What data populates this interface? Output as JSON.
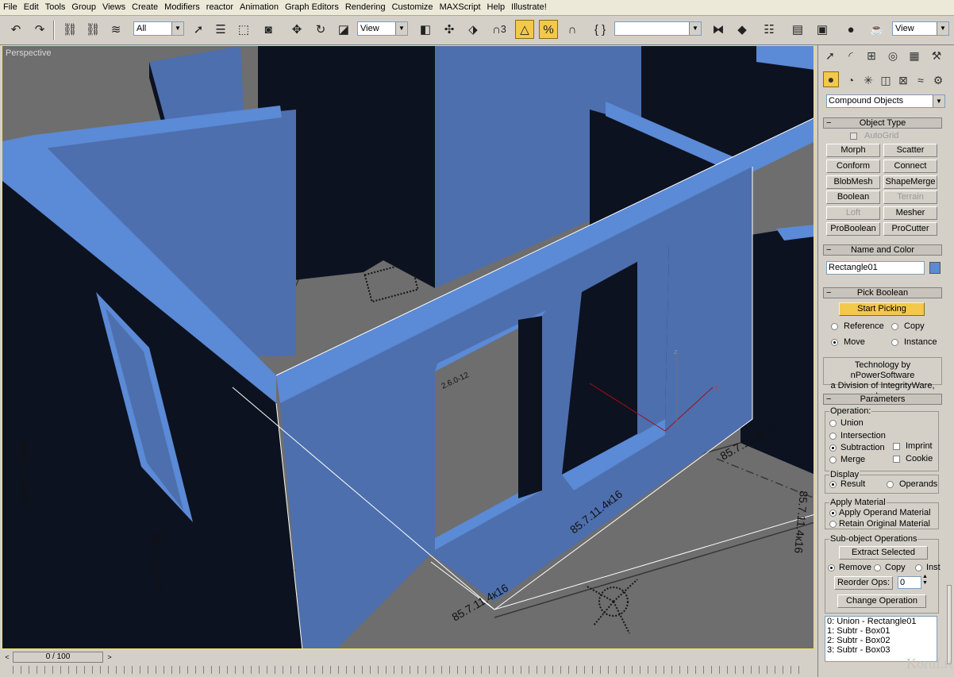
{
  "menu": [
    "File",
    "Edit",
    "Tools",
    "Group",
    "Views",
    "Create",
    "Modifiers",
    "reactor",
    "Animation",
    "Graph Editors",
    "Rendering",
    "Customize",
    "MAXScript",
    "Help",
    "Illustrate!"
  ],
  "toolbar": {
    "selection_filter": "All",
    "ref_coord": "View",
    "named_selection": "",
    "render_view": "View",
    "snap_label": "3"
  },
  "viewport": {
    "label": "Perspective",
    "dims": [
      "85.7.11.4к16",
      "85.7.11.4к16",
      "85.7.11.4к16",
      "85.7.11.4к14",
      "85.7.11.4к16",
      "85.7.11.4к12",
      "2.6.0-12"
    ],
    "axis": {
      "x": "x",
      "z": "z"
    },
    "colors": {
      "wall": "#4d6fae",
      "wall_top": "#5b8ad6",
      "shadow": "#0d1220",
      "floor": "#6e6e6e"
    }
  },
  "timebar": {
    "frame": "0 / 100"
  },
  "panel": {
    "category": "Compound Objects",
    "object_type": {
      "title": "Object Type",
      "autogrid": "AutoGrid",
      "buttons": [
        {
          "label": "Morph",
          "enabled": true
        },
        {
          "label": "Scatter",
          "enabled": true
        },
        {
          "label": "Conform",
          "enabled": true
        },
        {
          "label": "Connect",
          "enabled": true
        },
        {
          "label": "BlobMesh",
          "enabled": true
        },
        {
          "label": "ShapeMerge",
          "enabled": true
        },
        {
          "label": "Boolean",
          "enabled": true
        },
        {
          "label": "Terrain",
          "enabled": false
        },
        {
          "label": "Loft",
          "enabled": false
        },
        {
          "label": "Mesher",
          "enabled": true
        },
        {
          "label": "ProBoolean",
          "enabled": true
        },
        {
          "label": "ProCutter",
          "enabled": true
        }
      ]
    },
    "name_color": {
      "title": "Name and Color",
      "name": "Rectangle01",
      "color": "#5b8ad6"
    },
    "pick_boolean": {
      "title": "Pick Boolean",
      "start": "Start Picking",
      "reference": "Reference",
      "copy": "Copy",
      "move": "Move",
      "instance": "Instance"
    },
    "tech": {
      "line1": "Technology by nPowerSoftware",
      "line2": "a Division of IntegrityWare, Inc."
    },
    "parameters": {
      "title": "Parameters",
      "operation": "Operation:",
      "union": "Union",
      "intersection": "Intersection",
      "subtraction": "Subtraction",
      "merge": "Merge",
      "imprint": "Imprint",
      "cookie": "Cookie",
      "display": "Display",
      "result": "Result",
      "operands": "Operands",
      "apply_material": "Apply Material",
      "apply_operand": "Apply Operand Material",
      "retain_original": "Retain Original Material",
      "subobj": "Sub-object Operations",
      "extract": "Extract Selected",
      "remove": "Remove",
      "copy": "Copy",
      "inst": "Inst",
      "reorder": "Reorder Ops:",
      "reorder_value": "0",
      "change": "Change Operation",
      "ops": [
        "0: Union - Rectangle01",
        "1: Subtr - Box01",
        "2: Subtr - Box02",
        "3: Subtr - Box03"
      ]
    }
  },
  "watermark": "Koruf.ru"
}
